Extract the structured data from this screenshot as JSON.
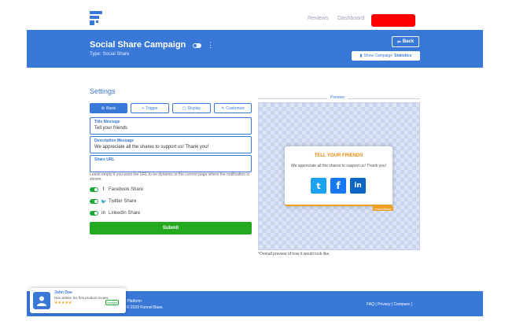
{
  "nav": {
    "links": [
      "Reviews",
      "Dashboard"
    ],
    "account_button_color": "#ff0000"
  },
  "header": {
    "title": "Social Share Campaign",
    "type": "Type: Social Share",
    "menu_glyph": "⋮",
    "back_label": "Back",
    "stats_label_prefix": "Show Campaign",
    "stats_label_strong": "Statistics"
  },
  "settings": {
    "title": "Settings",
    "tabs": [
      {
        "icon": "gear-icon",
        "label": "Basic",
        "active": true
      },
      {
        "icon": "trigger-icon",
        "label": "Trigger",
        "active": false
      },
      {
        "icon": "display-icon",
        "label": "Display",
        "active": false
      },
      {
        "icon": "customize-icon",
        "label": "Customize",
        "active": false
      }
    ],
    "fields": {
      "title": {
        "label": "Title Message",
        "value": "Tell your friends"
      },
      "description": {
        "label": "Description Message",
        "value": "We appreciate all the shares to support us! Thank you!"
      },
      "share_url": {
        "label": "Share URL",
        "value": "",
        "help": "Leave empty if you want the URL to be dynamic to the current page where the notification is shown."
      }
    },
    "share_options": [
      {
        "icon": "facebook-icon",
        "glyph": "f",
        "label": "Facebook Share",
        "enabled": true
      },
      {
        "icon": "twitter-icon",
        "glyph": "🐦",
        "label": "Twitter Share",
        "enabled": true
      },
      {
        "icon": "linkedin-icon",
        "glyph": "in",
        "label": "LinkedIn Share",
        "enabled": true
      }
    ],
    "submit_label": "Submit"
  },
  "preview": {
    "label": "Preview",
    "popup_title": "TELL YOUR FRIENDS",
    "popup_text": "We appreciate all the shares to support us! Thank you!",
    "buttons": [
      {
        "icon": "twitter-icon",
        "glyph": "t",
        "color": "#1da1f2"
      },
      {
        "icon": "facebook-icon",
        "glyph": "f",
        "color": "#1877f2"
      },
      {
        "icon": "linkedin-icon",
        "glyph": "in",
        "color": "#0a66c2"
      }
    ],
    "badge": "FunnelBase",
    "note": "*Overall preview of how it would look like."
  },
  "footer": {
    "tagline": "Marketing Platform",
    "copyright": "Copyright © 2020 Funnel Base.",
    "links": "FAQ | Privacy | Compare |"
  },
  "notification": {
    "name": "John Doe",
    "message": "Has written his first product review",
    "stars": "★★★★★",
    "badge": "Verified"
  },
  "colors": {
    "primary": "#3a78d8",
    "success": "#23a81f",
    "accent": "#f08a10"
  }
}
